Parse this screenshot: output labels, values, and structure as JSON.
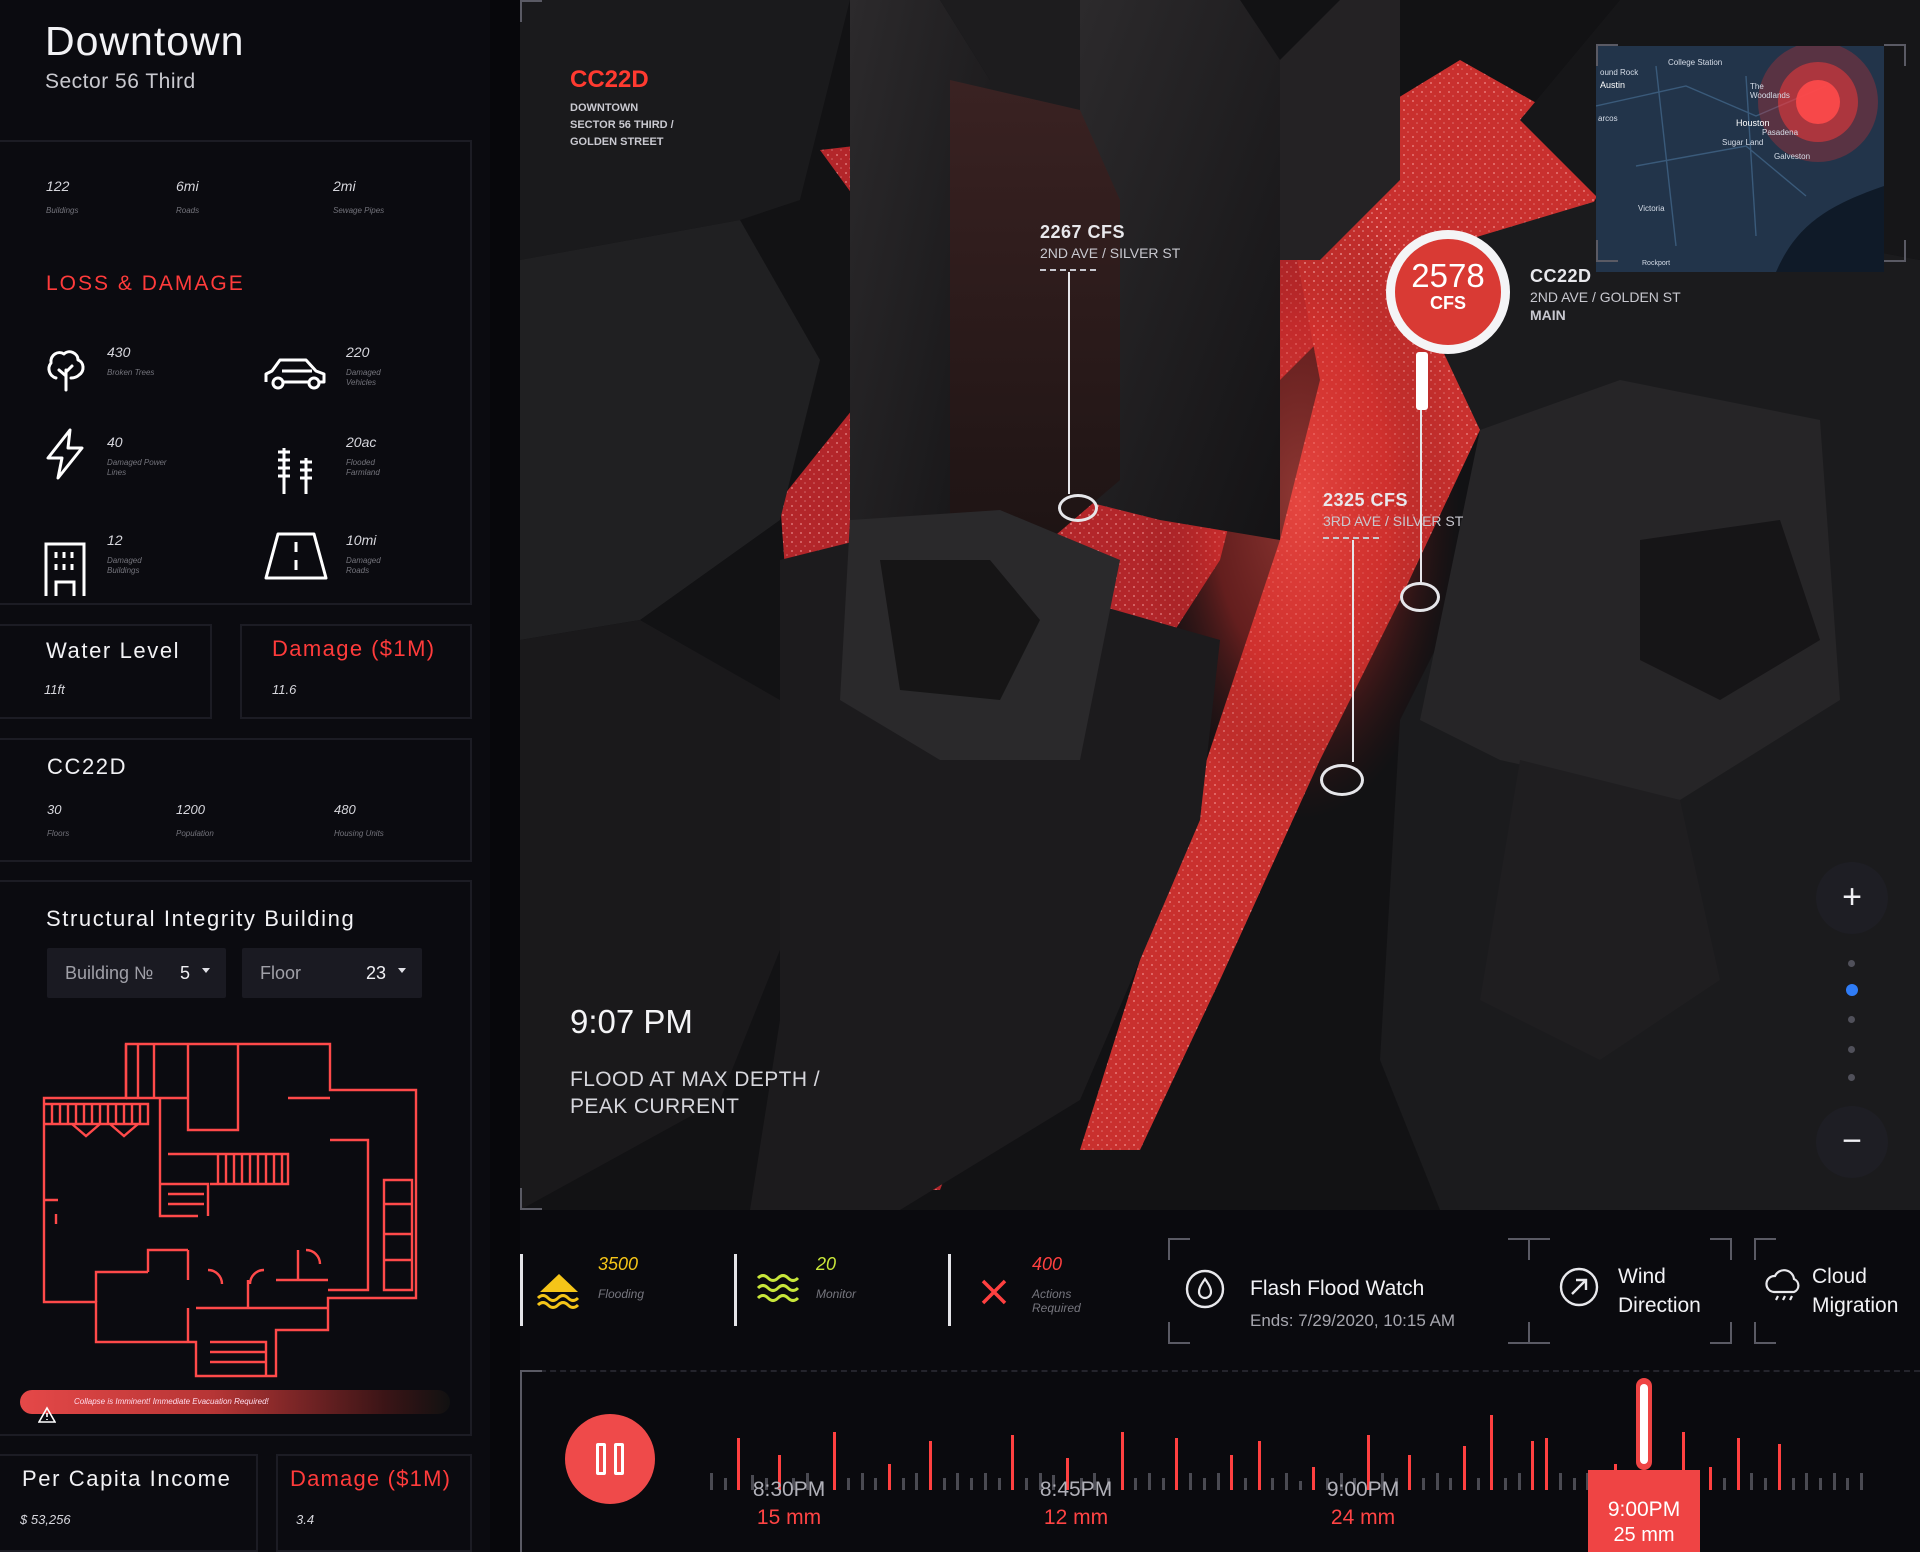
{
  "header": {
    "title": "Downtown",
    "subtitle": "Sector 56 Third"
  },
  "summary_stats": [
    {
      "value": "122",
      "label": "Buildings"
    },
    {
      "value": "6mi",
      "label": "Roads"
    },
    {
      "value": "2mi",
      "label": "Sewage Pipes"
    }
  ],
  "loss_damage": {
    "title": "LOSS & DAMAGE",
    "items": [
      {
        "icon": "tree-icon",
        "value": "430",
        "label": "Broken Trees"
      },
      {
        "icon": "car-icon",
        "value": "220",
        "label": "Damaged Vehicles"
      },
      {
        "icon": "lightning-icon",
        "value": "40",
        "label": "Damaged Power Lines"
      },
      {
        "icon": "crops-icon",
        "value": "20ac",
        "label": "Flooded Farmland"
      },
      {
        "icon": "building-icon",
        "value": "12",
        "label": "Damaged Buildings"
      },
      {
        "icon": "road-icon",
        "value": "10mi",
        "label": "Damaged Roads"
      }
    ]
  },
  "water_level": {
    "title": "Water Level",
    "value": "11ft"
  },
  "damage_top": {
    "title": "Damage ($1M)",
    "value": "11.6"
  },
  "building_info": {
    "title": "CC22D",
    "stats": [
      {
        "value": "30",
        "label": "Floors"
      },
      {
        "value": "1200",
        "label": "Population"
      },
      {
        "value": "480",
        "label": "Housing Units"
      }
    ]
  },
  "structural": {
    "title": "Structural Integrity Building",
    "building_label": "Building №",
    "building_value": "5",
    "floor_label": "Floor",
    "floor_value": "23",
    "alert": "Collapse is Imminent! Immediate Evacuation Required!"
  },
  "per_capita": {
    "title": "Per Capita Income",
    "value": "$ 53,256"
  },
  "damage_bottom": {
    "title": "Damage ($1M)",
    "value": "3.4"
  },
  "map": {
    "location_code": "CC22D",
    "location_lines": [
      "DOWNTOWN",
      "SECTOR 56 THIRD /",
      "GOLDEN STREET"
    ],
    "markers": [
      {
        "cfs": "2267 CFS",
        "street": "2ND AVE / SILVER ST"
      },
      {
        "cfs": "2325 CFS",
        "street": "3RD AVE / SILVER ST"
      }
    ],
    "main_marker": {
      "value": "2578",
      "unit": "CFS",
      "code": "CC22D",
      "street": "2ND AVE / GOLDEN ST",
      "tag": "MAIN"
    },
    "time": "9:07 PM",
    "description": "FLOOD AT MAX DEPTH / PEAK CURRENT",
    "minimap_labels": [
      "College Station",
      "ound Rock",
      "Austin",
      "The Woodlands",
      "Houston",
      "Pasadena",
      "Sugar Land",
      "Galveston",
      "Victoria",
      "Rockport",
      "arcos"
    ],
    "zoom_in": "+",
    "zoom_out": "−",
    "zoom_level_index": 1,
    "zoom_levels": 5
  },
  "legend": [
    {
      "icon": "flood-icon",
      "value": "3500",
      "label": "Flooding",
      "color": "#f5c518"
    },
    {
      "icon": "waves-icon",
      "value": "20",
      "label": "Monitor",
      "color": "#c8e63a"
    },
    {
      "icon": "close-icon",
      "value": "400",
      "label": "Actions Required",
      "color": "#ff4040"
    }
  ],
  "alerts": {
    "flash_flood": {
      "title": "Flash Flood Watch",
      "sub": "Ends: 7/29/2020, 10:15 AM"
    },
    "wind": {
      "title_lines": [
        "Wind",
        "Direction"
      ]
    },
    "cloud": {
      "title_lines": [
        "Cloud",
        "Migration"
      ]
    }
  },
  "timeline": {
    "marks": [
      {
        "time": "8:30PM",
        "mm": "15 mm"
      },
      {
        "time": "8:45PM",
        "mm": "12 mm"
      },
      {
        "time": "9:00PM",
        "mm": "24 mm"
      }
    ],
    "current": {
      "time": "9:00PM",
      "mm": "25 mm"
    },
    "ticks": [
      0.3,
      0.2,
      0.9,
      0.25,
      0.2,
      0.6,
      0.2,
      0.3,
      0.15,
      1.0,
      0.2,
      0.3,
      0.2,
      0.45,
      0.2,
      0.3,
      0.85,
      0.2,
      0.3,
      0.2,
      0.3,
      0.2,
      0.95,
      0.2,
      0.3,
      0.25,
      0.55,
      0.2,
      0.3,
      0.2,
      1.0,
      0.2,
      0.3,
      0.2,
      0.9,
      0.3,
      0.2,
      0.3,
      0.6,
      0.2,
      0.85,
      0.2,
      0.3,
      0.15,
      0.4,
      0.2,
      0.3,
      0.2,
      0.95,
      0.3,
      0.2,
      0.6,
      0.2,
      0.3,
      0.2,
      0.75,
      0.2,
      1.3,
      0.2,
      0.3,
      0.85,
      0.9,
      0.3,
      0.2,
      0.3,
      0.2,
      0.45,
      0.2,
      0.3,
      0.2,
      0.3,
      1.0,
      0.2,
      0.4,
      0.2,
      0.9,
      0.3,
      0.2,
      0.8,
      0.2,
      0.3,
      0.2,
      0.3,
      0.2,
      0.3
    ],
    "accent": "#ff4040"
  }
}
